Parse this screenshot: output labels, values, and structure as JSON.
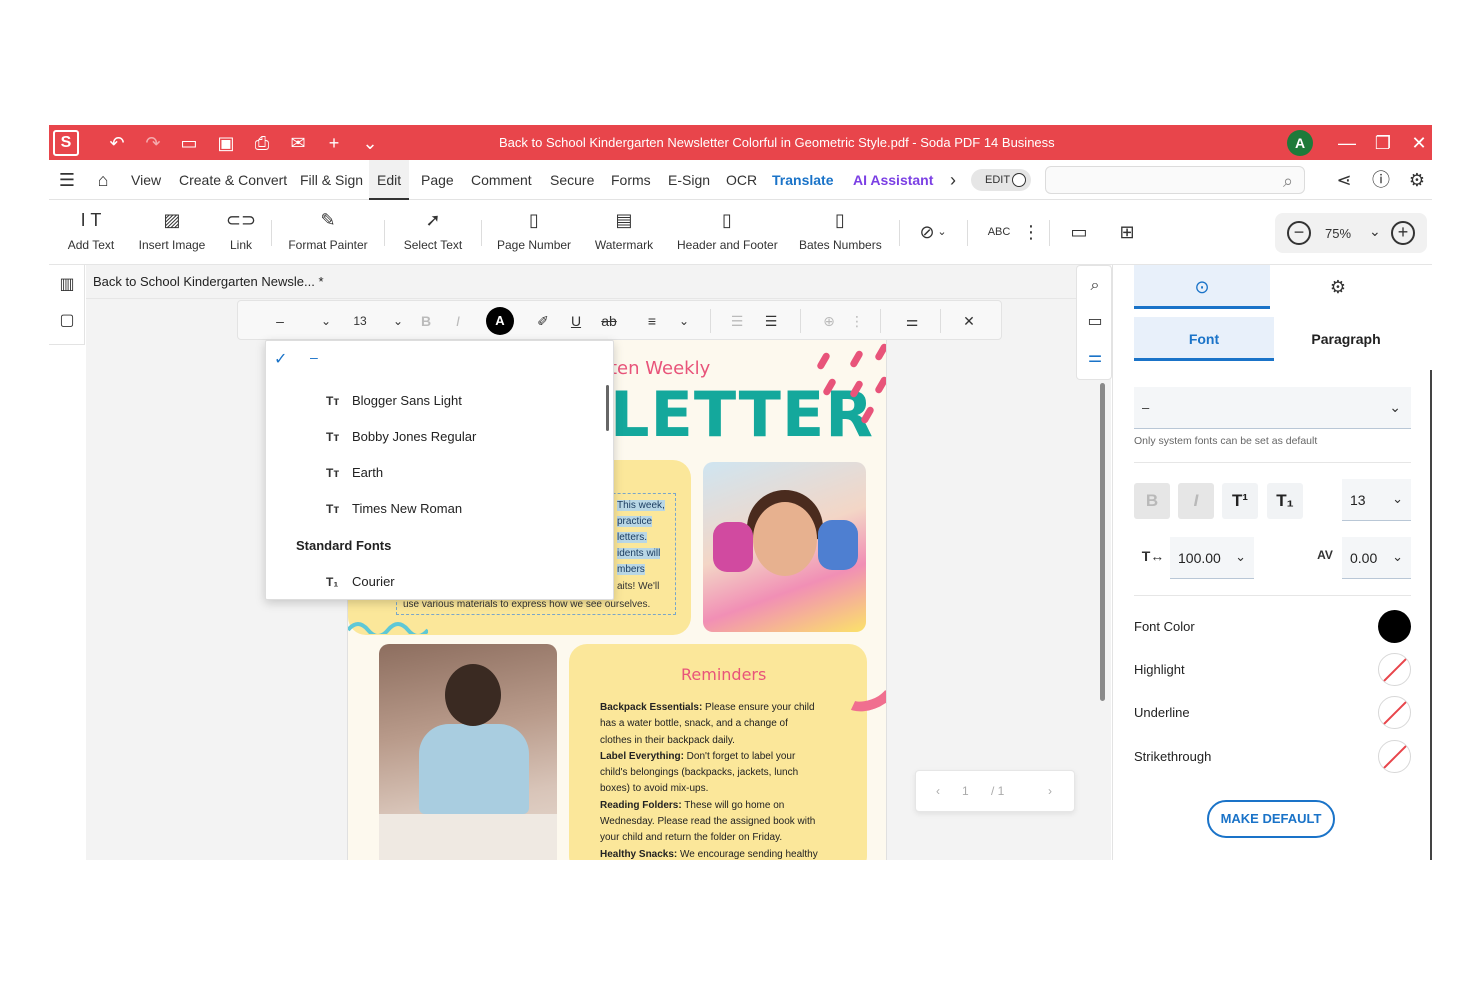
{
  "titlebar": {
    "logo": "S",
    "title": "Back to School Kindergarten Newsletter Colorful in Geometric Style.pdf  -  Soda PDF 14 Business",
    "avatar": "A",
    "accent": "#e8454b",
    "quick_icons": [
      "undo-icon",
      "redo-icon",
      "open-folder-icon",
      "save-icon",
      "print-icon",
      "mail-icon",
      "plus-icon",
      "chevron-down-icon"
    ],
    "window_icons": [
      "minimize-icon",
      "restore-icon",
      "close-icon"
    ]
  },
  "menubar": {
    "items": [
      "View",
      "Create & Convert",
      "Fill & Sign",
      "Edit",
      "Page",
      "Comment",
      "Secure",
      "Forms",
      "E-Sign",
      "OCR",
      "Translate",
      "AI Assistant"
    ],
    "active": "Edit",
    "edit_toggle": "EDIT",
    "search_placeholder": ""
  },
  "ribbon": {
    "buttons": [
      "Add Text",
      "Insert Image",
      "Link",
      "Format Painter",
      "Select Text",
      "Page Number",
      "Watermark",
      "Header and Footer",
      "Bates Numbers"
    ],
    "zoom": "75%"
  },
  "document": {
    "tab_name": "Back to School Kindergarten Newsle... *"
  },
  "format_toolbar": {
    "font": "–",
    "size": "13",
    "color_letter": "A"
  },
  "font_dropdown": {
    "selected": "–",
    "options": [
      "Blogger Sans Light",
      "Bobby Jones Regular",
      "Earth",
      "Times New Roman"
    ],
    "group_label": "Standard Fonts",
    "standard_options": [
      "Courier"
    ]
  },
  "page": {
    "headline_small": "ten Weekly",
    "headline_big": "LETTER",
    "selected_lines": [
      "This week,",
      "practice",
      "letters.",
      "idents will",
      "mbers"
    ],
    "plain_lines": [
      "aits! We'll"
    ],
    "last_line": "use various materials to express how we see ourselves.",
    "reminders_title": "Reminders",
    "reminders": [
      {
        "b": "Backpack Essentials:",
        "t": " Please ensure your child"
      },
      {
        "b": "",
        "t": "has a water bottle, snack, and a change of"
      },
      {
        "b": "",
        "t": "clothes in their backpack daily."
      },
      {
        "b": "Label Everything:",
        "t": " Don't forget to label your"
      },
      {
        "b": "",
        "t": "child's belongings (backpacks, jackets, lunch"
      },
      {
        "b": "",
        "t": "boxes) to avoid mix-ups."
      },
      {
        "b": "Reading Folders:",
        "t": " These will go home on"
      },
      {
        "b": "",
        "t": "Wednesday. Please read the assigned book with"
      },
      {
        "b": "",
        "t": "your child and return the folder on Friday."
      },
      {
        "b": "Healthy Snacks:",
        "t": " We encourage sending healthy"
      }
    ]
  },
  "page_nav": {
    "current": "1",
    "total": "/ 1"
  },
  "right_panel": {
    "tabs": [
      "Font",
      "Paragraph"
    ],
    "active_tab": "Font",
    "font_value": "–",
    "hint": "Only system fonts can be set as default",
    "size": "13",
    "scale": "100.00",
    "spacing": "0.00",
    "props": [
      "Font Color",
      "Highlight",
      "Underline",
      "Strikethrough"
    ],
    "font_color": "#000000",
    "make_default": "MAKE DEFAULT"
  }
}
